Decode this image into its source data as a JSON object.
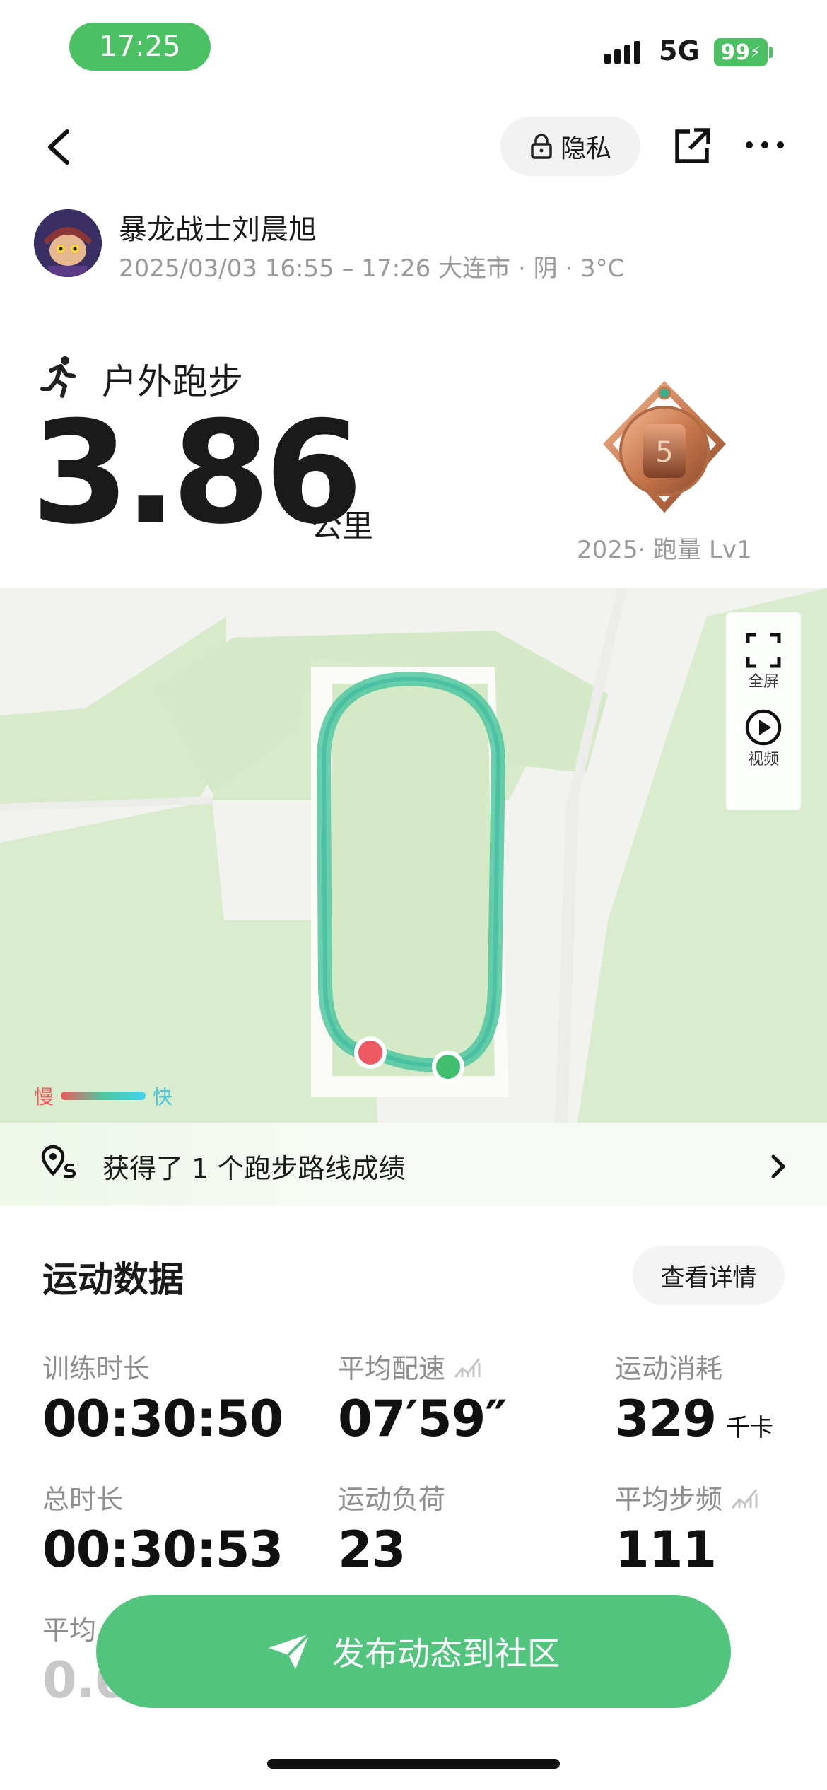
{
  "status_bar": {
    "time": "17:25",
    "network": "5G",
    "battery": "99"
  },
  "header": {
    "privacy_label": "隐私"
  },
  "user": {
    "name": "暴龙战士刘晨旭",
    "meta": "2025/03/03 16:55 – 17:26 大连市 · 阴 · 3°C"
  },
  "activity": {
    "type": "户外跑步",
    "distance": "3.86",
    "distance_unit": "公里",
    "medal_caption": "2025· 跑量 Lv1",
    "medal_number": "5"
  },
  "map": {
    "fullscreen_label": "全屏",
    "video_label": "视频",
    "legend_slow": "慢",
    "legend_fast": "快",
    "start_color": "#3fbf6f",
    "end_color": "#ee5a64",
    "route_color": "#4fc7a0"
  },
  "banner": {
    "text": "获得了 1 个跑步路线成绩"
  },
  "stats": {
    "title": "运动数据",
    "detail_button": "查看详情",
    "items": [
      {
        "label": "训练时长",
        "value": "00:30:50",
        "unit": ""
      },
      {
        "label": "平均配速",
        "value": "07′59″",
        "unit": ""
      },
      {
        "label": "运动消耗",
        "value": "329",
        "unit": "千卡"
      },
      {
        "label": "总时长",
        "value": "00:30:53",
        "unit": ""
      },
      {
        "label": "运动负荷",
        "value": "23",
        "unit": ""
      },
      {
        "label": "平均步频",
        "value": "111",
        "unit": ""
      },
      {
        "label": "平均",
        "value": "0.6",
        "unit": ""
      }
    ]
  },
  "publish_button": "发布动态到社区"
}
